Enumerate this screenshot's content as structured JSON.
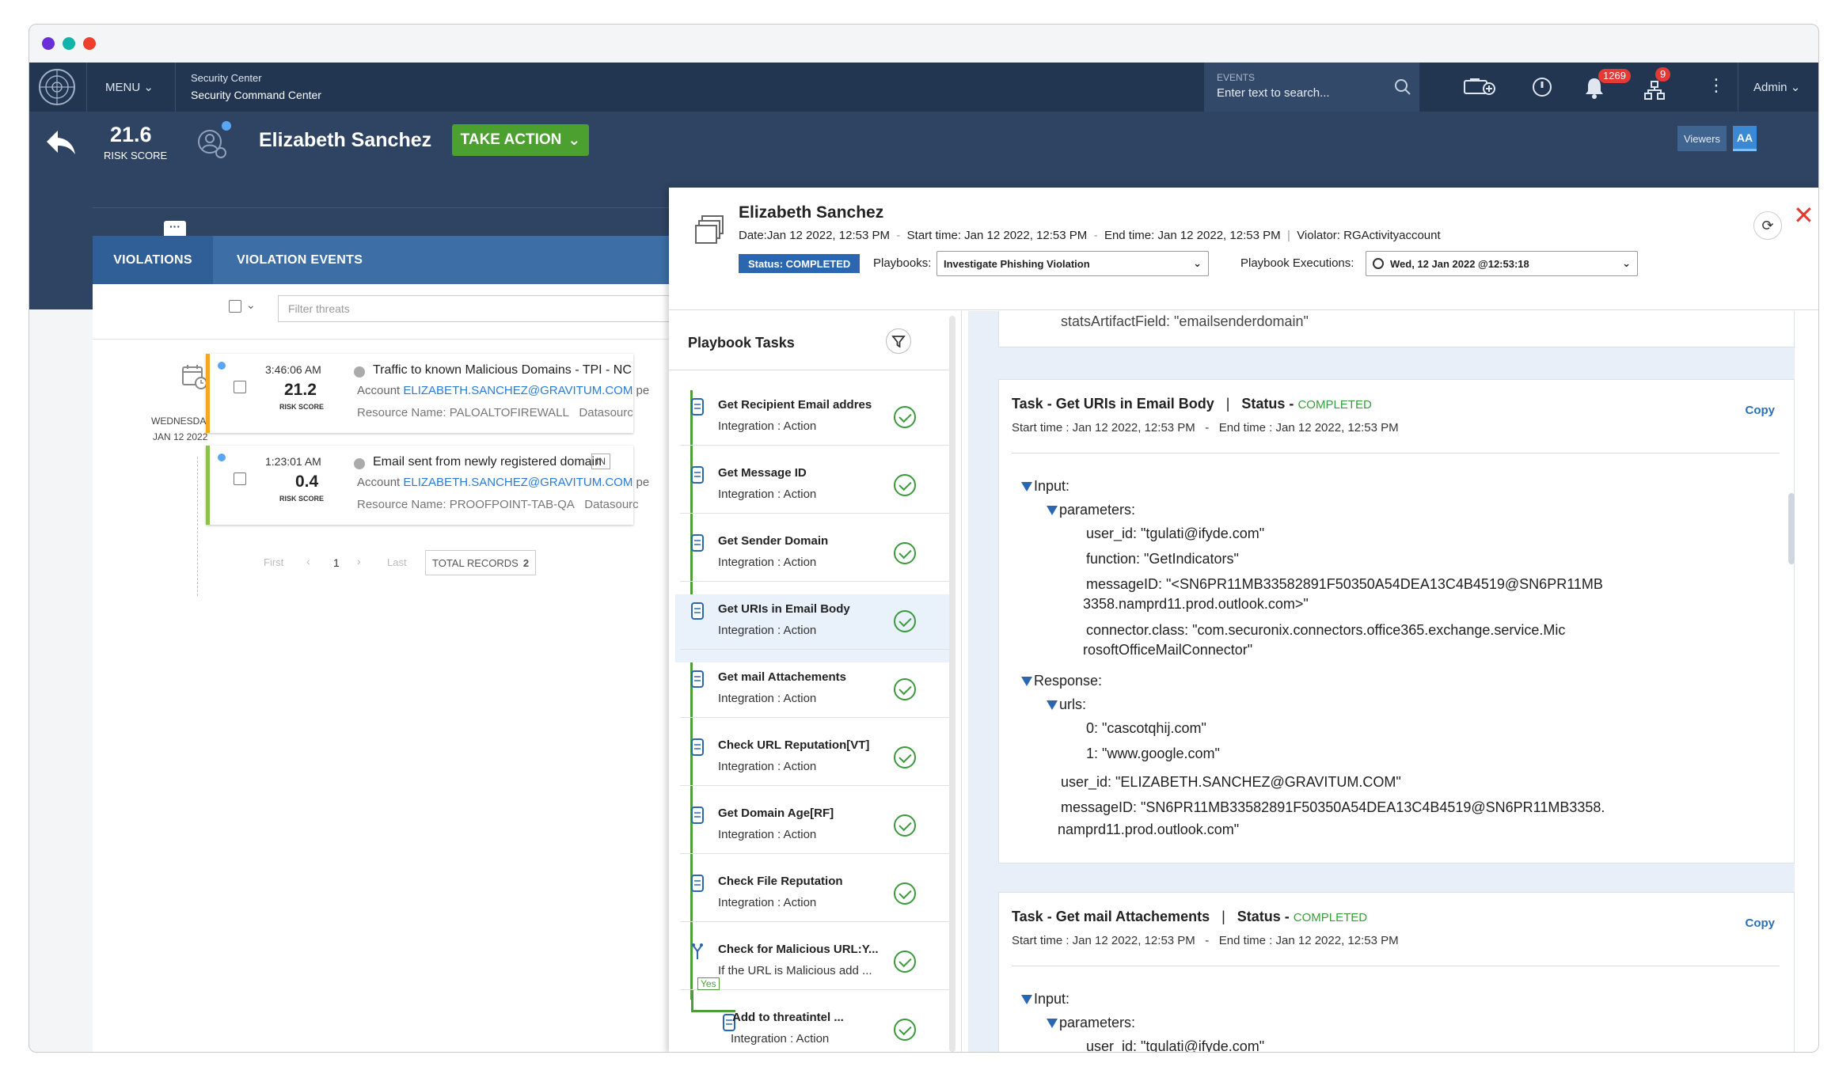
{
  "nav": {
    "menu": "MENU",
    "breadcrumb_top": "Security Center",
    "breadcrumb_bottom": "Security Command Center",
    "search_label": "EVENTS",
    "search_placeholder": "Enter text to search...",
    "alerts_count": "1269",
    "network_count": "9",
    "user": "Admin"
  },
  "header": {
    "risk_score": "21.6",
    "risk_label": "RISK SCORE",
    "name": "Elizabeth Sanchez",
    "take_action": "TAKE ACTION",
    "viewers_label": "Viewers",
    "viewer_initials": "AA"
  },
  "tabs": [
    "VIOLATIONS",
    "VIOLATION EVENTS"
  ],
  "filter": {
    "placeholder": "Filter threats"
  },
  "date": {
    "weekday": "WEDNESDAY",
    "day": "JAN 12 2022"
  },
  "violations": [
    {
      "time": "3:46:06 AM",
      "score": "21.2",
      "score_label": "RISK SCORE",
      "title": "Traffic to known Malicious Domains - TPI - NC",
      "account_label": "Account",
      "account": "ELIZABETH.SANCHEZ@GRAVITUM.COM",
      "account_tail": "pe",
      "resource": "Resource Name: PALOALTOFIREWALL",
      "datasource": "Datasourc",
      "accent": "#f5a623"
    },
    {
      "time": "1:23:01 AM",
      "score": "0.4",
      "score_label": "RISK SCORE",
      "title": "Email sent from newly registered domain",
      "tag": "IN",
      "account_label": "Account",
      "account": "ELIZABETH.SANCHEZ@GRAVITUM.COM",
      "account_tail": "pe",
      "resource": "Resource Name: PROOFPOINT-TAB-QA",
      "datasource": "Datasourc",
      "accent": "#8bc34a"
    }
  ],
  "pagination": {
    "first": "First",
    "page": "1",
    "last": "Last",
    "total_label": "TOTAL RECORDS",
    "total": "2"
  },
  "playbook": {
    "name": "Elizabeth Sanchez",
    "date": "Date:Jan 12 2022, 12:53 PM",
    "start": "Start time: Jan 12 2022, 12:53 PM",
    "end": "End time: Jan 12 2022, 12:53 PM",
    "violator": "Violator: RGActivityaccount",
    "status": "Status: COMPLETED",
    "playbooks_label": "Playbooks:",
    "playbook_selected": "Investigate Phishing Violation",
    "executions_label": "Playbook Executions:",
    "execution_selected": "Wed, 12 Jan 2022 @12:53:18"
  },
  "tasks_title": "Playbook Tasks",
  "tasks": [
    {
      "name": "Get Recipient Email addres",
      "sub": "Integration : Action"
    },
    {
      "name": "Get Message ID",
      "sub": "Integration : Action"
    },
    {
      "name": "Get Sender Domain",
      "sub": "Integration : Action"
    },
    {
      "name": "Get URIs in Email Body",
      "sub": "Integration : Action"
    },
    {
      "name": "Get mail Attachements",
      "sub": "Integration : Action"
    },
    {
      "name": "Check URL Reputation[VT]",
      "sub": "Integration : Action"
    },
    {
      "name": "Get Domain Age[RF]",
      "sub": "Integration : Action"
    },
    {
      "name": "Check File Reputation",
      "sub": "Integration : Action"
    },
    {
      "name": "Check for Malicious URL:Y...",
      "sub": "If the URL is Malicious add ..."
    },
    {
      "name": "Add to threatintel ...",
      "sub": "Integration : Action"
    }
  ],
  "yes_label": "Yes",
  "detail": {
    "prev_tail": "statsArtifactField: \"emailsenderdomain\"",
    "card1": {
      "title": "Task - Get URIs in Email Body",
      "status_label": "Status -",
      "status": "COMPLETED",
      "start": "Start time : Jan 12 2022, 12:53 PM",
      "end": "End time : Jan 12 2022, 12:53 PM",
      "copy": "Copy",
      "input": "Input:",
      "parameters": "parameters:",
      "p1": "user_id: \"tgulati@ifyde.com\"",
      "p2": "function: \"GetIndicators\"",
      "p3a": "messageID: \"<SN6PR11MB33582891F50350A54DEA13C4B4519@SN6PR11MB",
      "p3b": "3358.namprd11.prod.outlook.com>\"",
      "p4a": "connector.class: \"com.securonix.connectors.office365.exchange.service.Mic",
      "p4b": "rosoftOfficeMailConnector\"",
      "response": "Response:",
      "urls": "urls:",
      "u0": "0: \"cascotqhij.com\"",
      "u1": "1: \"www.google.com\"",
      "r1": "user_id: \"ELIZABETH.SANCHEZ@GRAVITUM.COM\"",
      "r2a": "messageID: \"SN6PR11MB33582891F50350A54DEA13C4B4519@SN6PR11MB3358.",
      "r2b": "namprd11.prod.outlook.com\""
    },
    "card2": {
      "title": "Task - Get mail Attachements",
      "status_label": "Status -",
      "status": "COMPLETED",
      "start": "Start time : Jan 12 2022, 12:53 PM",
      "end": "End time : Jan 12 2022, 12:53 PM",
      "copy": "Copy",
      "input": "Input:",
      "parameters": "parameters:",
      "p1": "user_id: \"tgulati@ifyde.com\""
    }
  },
  "colors": {
    "nav": "#223652",
    "header": "#2e4462",
    "accent_green": "#4ba02f",
    "status_blue": "#2a67b0",
    "completed": "#3b9a3b",
    "close": "#e53935"
  }
}
